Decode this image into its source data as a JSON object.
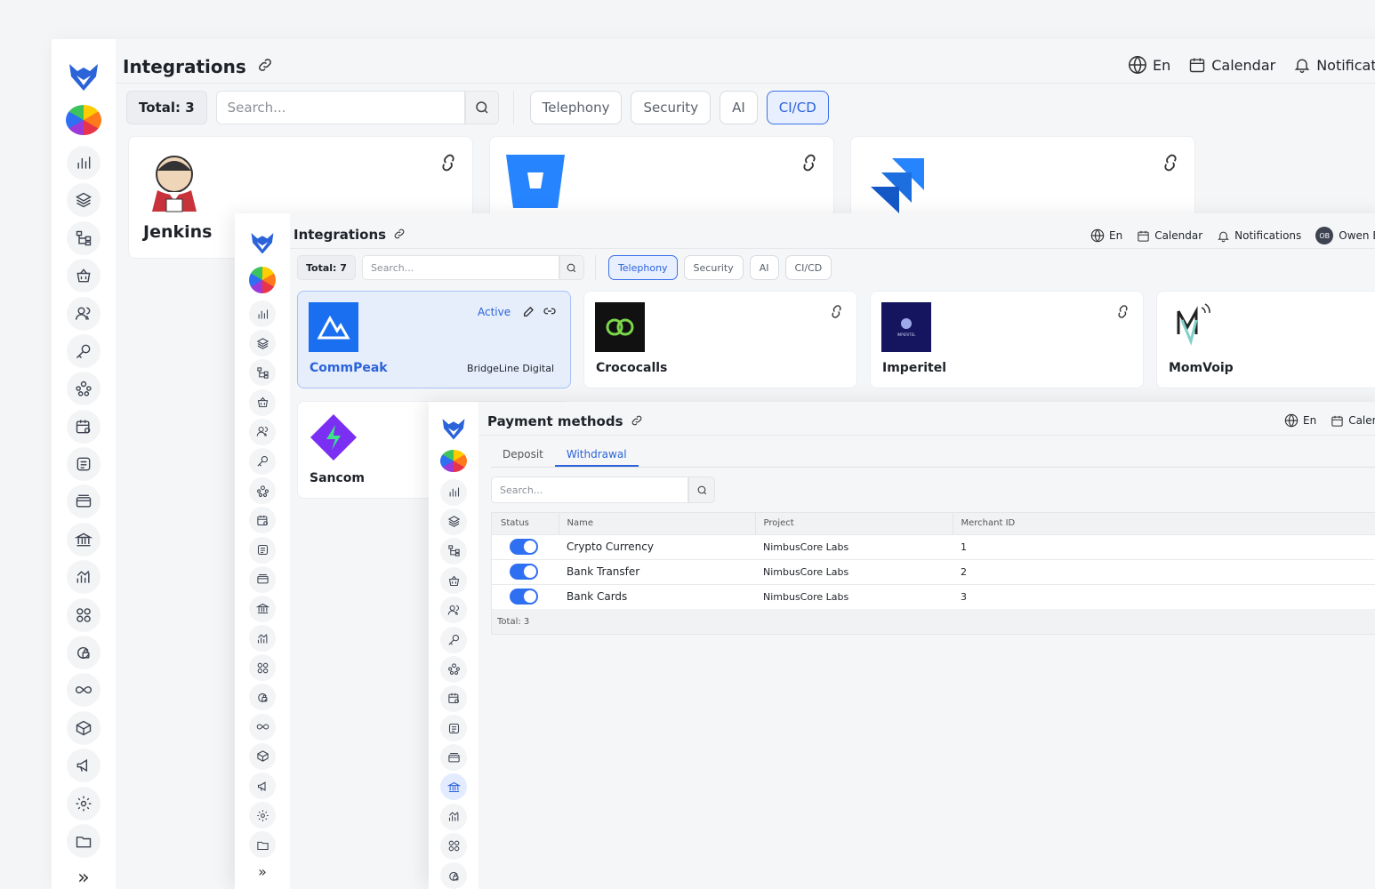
{
  "win1": {
    "title": "Integrations",
    "top_right": {
      "lang": "En",
      "calendar": "Calendar",
      "notifications": "Notificatio"
    },
    "total": "Total: 3",
    "search_placeholder": "Search...",
    "chips": [
      "Telephony",
      "Security",
      "AI",
      "CI/CD"
    ],
    "active_chip": "CI/CD",
    "cards": [
      {
        "name": "Jenkins"
      },
      {
        "name": ""
      },
      {
        "name": ""
      }
    ]
  },
  "win2": {
    "title": "Integrations",
    "top_right": {
      "lang": "En",
      "calendar": "Calendar",
      "notifications": "Notifications",
      "avatar": "OB",
      "user": "Owen B"
    },
    "total": "Total: 7",
    "search_placeholder": "Search...",
    "chips": [
      "Telephony",
      "Security",
      "AI",
      "CI/CD"
    ],
    "active_chip": "Telephony",
    "cards": [
      {
        "name": "CommPeak",
        "status": "Active",
        "project": "BridgeLine Digital"
      },
      {
        "name": "Crococalls"
      },
      {
        "name": "Imperitel",
        "logo_text": "IMPERITEL"
      },
      {
        "name": "MomVoip"
      },
      {
        "name": "Sancom"
      }
    ]
  },
  "win3": {
    "title": "Payment methods",
    "top_right": {
      "lang": "En",
      "calendar": "Caler"
    },
    "tabs": [
      "Deposit",
      "Withdrawal"
    ],
    "active_tab": "Withdrawal",
    "search_placeholder": "Search...",
    "table": {
      "headers": [
        "Status",
        "Name",
        "Project",
        "Merchant ID"
      ],
      "rows": [
        {
          "name": "Crypto Currency",
          "project": "NimbusCore Labs",
          "merchant_id": "1",
          "enabled": true
        },
        {
          "name": "Bank Transfer",
          "project": "NimbusCore Labs",
          "merchant_id": "2",
          "enabled": true
        },
        {
          "name": "Bank Cards",
          "project": "NimbusCore Labs",
          "merchant_id": "3",
          "enabled": true
        }
      ],
      "total": "Total: 3"
    }
  },
  "sidebar_icons": [
    "bar-chart-icon",
    "layers-icon",
    "hierarchy-icon",
    "basket-icon",
    "users-icon",
    "key-icon",
    "team-icon",
    "calendar-settings-icon",
    "notes-icon",
    "cards-icon",
    "bank-icon",
    "analytics-icon",
    "grid-icon",
    "lock-refresh-icon",
    "infinity-icon",
    "box-icon",
    "megaphone-icon",
    "gear-icon",
    "folder-icon"
  ],
  "colors": {
    "accent": "#2b63d9",
    "toggle": "#2f6ff2",
    "active_card_bg": "#e6eefc"
  }
}
